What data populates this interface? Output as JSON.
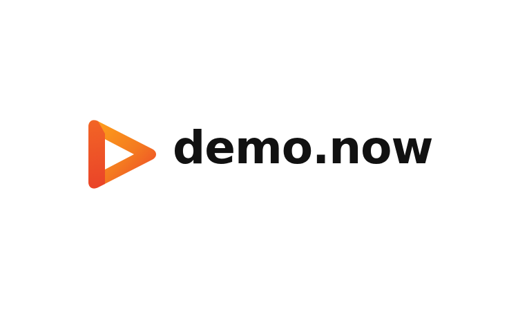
{
  "brand": {
    "name": "demo.now",
    "logo_icon": "play-triangle-icon",
    "colors": {
      "text": "#111111",
      "icon_gradient_start": "#f47b20",
      "icon_gradient_end": "#ec3f2b",
      "icon_highlight": "#ffa31a",
      "background": "#ffffff"
    }
  }
}
